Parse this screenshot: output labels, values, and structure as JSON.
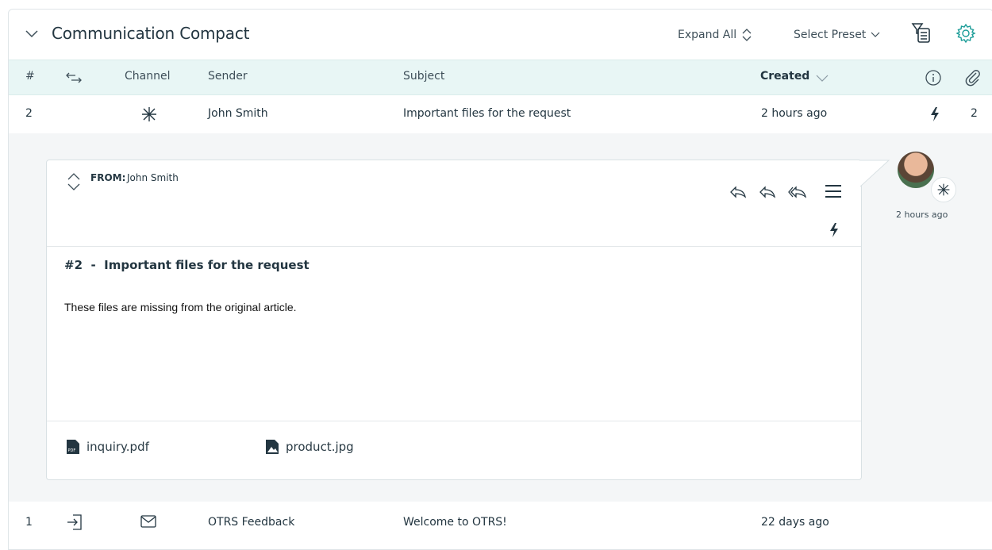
{
  "widget": {
    "title": "Communication Compact",
    "expand_all_label": "Expand All",
    "select_preset_label": "Select Preset"
  },
  "columns": {
    "number": "#",
    "channel": "Channel",
    "sender": "Sender",
    "subject": "Subject",
    "created": "Created"
  },
  "rows": [
    {
      "number": "2",
      "sender": "John Smith",
      "subject": "Important files for the request",
      "created": "2 hours ago",
      "attachments": "2",
      "channel_icon": "internal-asterisk-icon"
    },
    {
      "number": "1",
      "sender": "OTRS Feedback",
      "subject": "Welcome to OTRS!",
      "created": "22 days ago",
      "channel_icon": "email-icon"
    }
  ],
  "article": {
    "from_label": "FROM:",
    "from_name": "John Smith",
    "title": "#2  -  Important files for the request",
    "body": "These files are missing from the original article.",
    "attachments": [
      {
        "name": "inquiry.pdf",
        "icon": "pdf-icon"
      },
      {
        "name": "product.jpg",
        "icon": "image-icon"
      }
    ],
    "time": "2 hours ago"
  },
  "colors": {
    "accent": "#1a9c97",
    "column_header_bg": "#e8f6f5",
    "expanded_bg": "#f4f6f7"
  }
}
